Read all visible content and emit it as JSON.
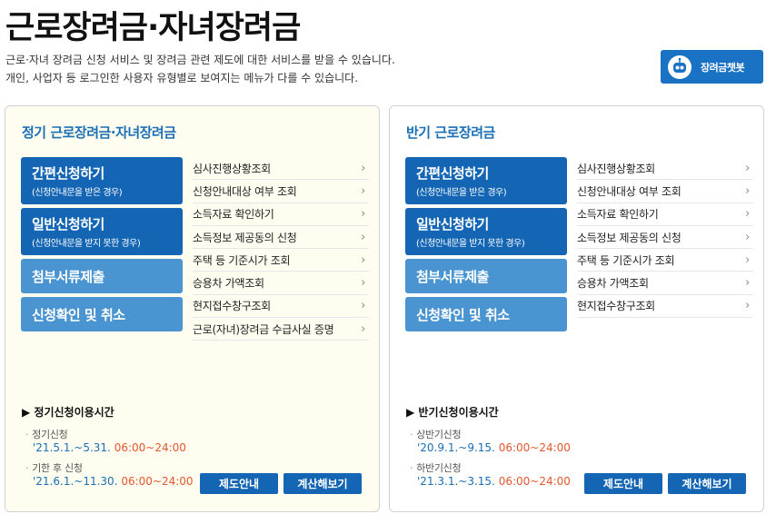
{
  "page": {
    "title": "근로장려금·자녀장려금",
    "intro_line1": "근로·자녀 장려금 신청 서비스 및 장려금 관련 제도에 대한 서비스를 받을 수 있습니다.",
    "intro_line2": "개인, 사업자 등 로그인한 사용자 유형별로 보여지는 메뉴가 다를 수 있습니다."
  },
  "chatbot": {
    "label": "장려금챗봇",
    "icon": "robot-icon"
  },
  "panels": {
    "regular": {
      "title": "정기 근로장려금·자녀장려금",
      "buttons": [
        {
          "title": "간편신청하기",
          "sub": "(신청안내문을 받은 경우)"
        },
        {
          "title": "일반신청하기",
          "sub": "(신청안내문을 받지 못한 경우)"
        },
        {
          "title": "첨부서류제출"
        },
        {
          "title": "신청확인 및 취소"
        }
      ],
      "links": [
        "심사진행상황조회",
        "신청안내대상 여부 조회",
        "소득자료 확인하기",
        "소득정보 제공동의 신청",
        "주택 등 기준시가 조회",
        "승용차 가액조회",
        "현지접수창구조회",
        "근로(자녀)장려금 수급사실 증명"
      ],
      "time_title": "▶ 정기신청이용시간",
      "schedules": [
        {
          "label": "정기신청",
          "dates": "'21.5.1.~5.31.",
          "hours": "06:00~24:00"
        },
        {
          "label": "기한 후 신청",
          "dates": "'21.6.1.~11.30.",
          "hours": "06:00~24:00"
        }
      ],
      "guide_button": "제도안내",
      "calc_button": "계산해보기"
    },
    "half": {
      "title": "반기 근로장려금",
      "buttons": [
        {
          "title": "간편신청하기",
          "sub": "(신청안내문을 받은 경우)"
        },
        {
          "title": "일반신청하기",
          "sub": "(신청안내문을 받지 못한 경우)"
        },
        {
          "title": "첨부서류제출"
        },
        {
          "title": "신청확인 및 취소"
        }
      ],
      "links": [
        "심사진행상황조회",
        "신청안내대상 여부 조회",
        "소득자료 확인하기",
        "소득정보 제공동의 신청",
        "주택 등 기준시가 조회",
        "승용차 가액조회",
        "현지접수창구조회"
      ],
      "time_title": "▶ 반기신청이용시간",
      "schedules": [
        {
          "label": "상반기신청",
          "dates": "'20.9.1.~9.15.",
          "hours": "06:00~24:00"
        },
        {
          "label": "하반기신청",
          "dates": "'21.3.1.~3.15.",
          "hours": "06:00~24:00"
        }
      ],
      "guide_button": "제도안내",
      "calc_button": "계산해보기"
    }
  },
  "colors": {
    "primary": "#1466b4",
    "secondary": "#4a95d1",
    "accent_time": "#e4572e",
    "regular_panel_bg": "#fffdf0"
  }
}
